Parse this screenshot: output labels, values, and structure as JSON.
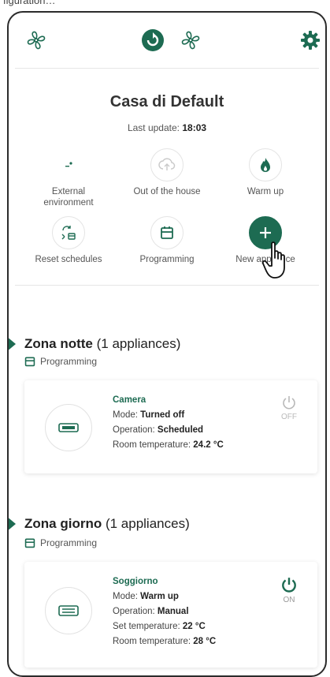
{
  "caption": "figuration…",
  "house": {
    "name": "Casa di Default",
    "update_label": "Last update:",
    "update_time": "18:03"
  },
  "actions": [
    {
      "label": "External environment",
      "icon": "external-environment-icon"
    },
    {
      "label": "Out of the house",
      "icon": "out-of-house-icon"
    },
    {
      "label": "Warm up",
      "icon": "flame-icon"
    },
    {
      "label": "Reset schedules",
      "icon": "reset-schedules-icon"
    },
    {
      "label": "Programming",
      "icon": "calendar-icon"
    },
    {
      "label": "New appliance",
      "icon": "plus-icon"
    }
  ],
  "zones": [
    {
      "name": "Zona notte",
      "count": "(1 appliances)",
      "mode": "Programming",
      "device": {
        "name": "Camera",
        "lines": [
          {
            "k": "Mode:",
            "v": "Turned off"
          },
          {
            "k": "Operation:",
            "v": "Scheduled"
          },
          {
            "k": "Room temperature:",
            "v": "24.2 °C"
          }
        ],
        "power": "OFF"
      }
    },
    {
      "name": "Zona giorno",
      "count": "(1 appliances)",
      "mode": "Programming",
      "device": {
        "name": "Soggiorno",
        "lines": [
          {
            "k": "Mode:",
            "v": "Warm up"
          },
          {
            "k": "Operation:",
            "v": "Manual"
          },
          {
            "k": "Set temperature:",
            "v": "22 °C"
          },
          {
            "k": "Room temperature:",
            "v": "28 °C"
          }
        ],
        "power": "ON"
      }
    }
  ],
  "colors": {
    "accent": "#1d6b52",
    "power_off": "#b9b9b9",
    "power_on": "#1d6b52"
  }
}
